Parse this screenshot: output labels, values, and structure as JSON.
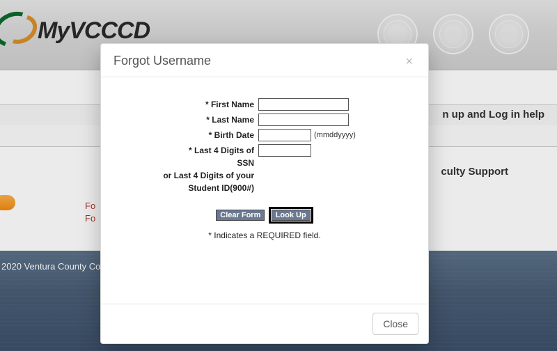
{
  "header": {
    "logo_text": "MyVCCCD"
  },
  "background": {
    "help_fragment": "n up and Log in help",
    "faculty_fragment": "culty Support",
    "red_link_1": "Fo",
    "red_link_2": "Fo",
    "footer": "2020 Ventura County Com"
  },
  "modal": {
    "title": "Forgot Username",
    "close_x": "×",
    "form": {
      "first_name_label": "* First Name",
      "last_name_label": "* Last Name",
      "birth_date_label": "* Birth Date",
      "birth_date_hint": "(mmddyyyy)",
      "ssn_label_line1": "* Last 4 Digits of",
      "ssn_label_line2": "SSN",
      "ssn_label_line3": "or Last 4 Digits of your",
      "ssn_label_line4": "Student ID(900#)",
      "first_name_value": "",
      "last_name_value": "",
      "birth_date_value": "",
      "ssn_value": "",
      "clear_button": "Clear Form",
      "lookup_button": "Look Up",
      "required_note": "* Indicates a REQUIRED field."
    },
    "footer_close": "Close"
  }
}
